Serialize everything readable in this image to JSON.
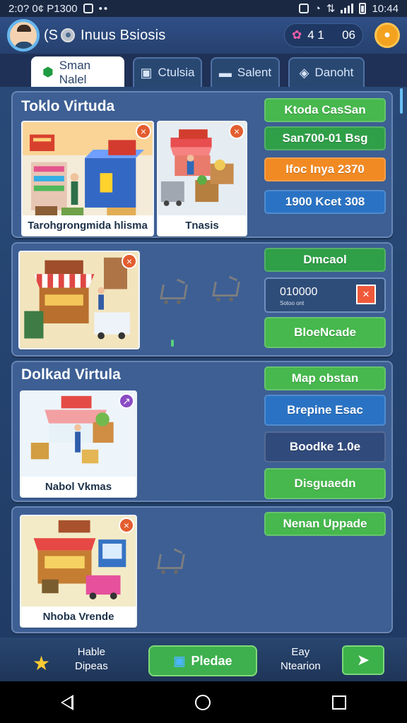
{
  "status": {
    "left_text": "2:0? 0¢ P1300",
    "time": "10:44"
  },
  "header": {
    "prefix": "(S",
    "title": "Inuus Bsiosis",
    "currency_a": "4 1",
    "currency_b": "06"
  },
  "tabs": [
    {
      "label": "Sman Nalel",
      "icon": "shield-check-icon"
    },
    {
      "label": "Ctulsia",
      "icon": "clipboard-icon"
    },
    {
      "label": "Salent",
      "icon": "truck-icon"
    },
    {
      "label": "Danoht",
      "icon": "bag-icon"
    }
  ],
  "cards": {
    "card1": {
      "title": "Toklo Virtuda",
      "thumb1_caption": "Tarohgrongmida hlisma",
      "thumb2_caption": "Tnasis",
      "buttons": [
        "Ktoda CasSan",
        "San700-01 Bsg",
        "Ifoc Inya 2370",
        "1900 Kcet 308"
      ]
    },
    "card2": {
      "button_top": "Dmcaol",
      "value_main": "010000",
      "value_sub": "Sotoo ont",
      "button_bottom": "BloeNcade"
    },
    "card3": {
      "title": "Dolkad Virtula",
      "thumb_caption": "Nabol Vkmas",
      "buttons": [
        "Map obstan",
        "Brepine Esac",
        "Boodke 1.0e",
        "Disguaedn"
      ]
    },
    "card4": {
      "thumb_caption": "Nhoba Vrende",
      "button": "Nenan Uppade"
    }
  },
  "bottom_bar": {
    "left_text_line1": "Hable",
    "left_text_line2": "Dipeas",
    "main_button": "Pledae",
    "right_text_line1": "Eay",
    "right_text_line2": "Ntearion"
  },
  "colors": {
    "primary_green": "#46b84d",
    "accent_orange": "#f28a23",
    "accent_blue": "#2a73c4",
    "background_navy": "#203c66"
  }
}
